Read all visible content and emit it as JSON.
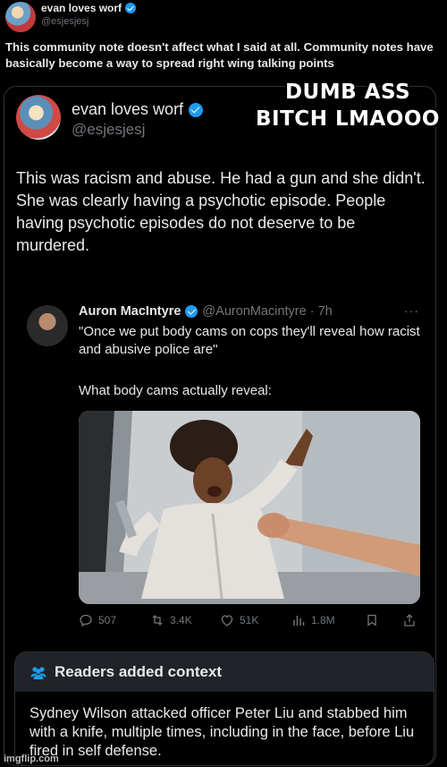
{
  "outer_tweet": {
    "name": "evan loves worf",
    "handle": "@esjesjesj",
    "text": "This community note doesn't affect what I said at all. Community notes have basically become a way to spread right wing talking points"
  },
  "meme_caption": "DUMB ASS BITCH LMAOOO",
  "quoted_tweet": {
    "name": "evan loves worf",
    "handle": "@esjesjesj",
    "text": "This was racism and abuse. He had a gun and she didn't. She was clearly having a psychotic episode. People having psychotic episodes do not deserve to be murdered."
  },
  "inner_tweet": {
    "name": "Auron MacIntyre",
    "handle_time": "@AuronMacintyre · 7h",
    "more": "···",
    "quote_text": "\"Once we put body cams on cops they'll reveal how racist and abusive police are\"",
    "caption": "What body cams actually reveal:",
    "actions": {
      "replies": "507",
      "reposts": "3.4K",
      "likes": "51K",
      "views": "1.8M"
    }
  },
  "community_note": {
    "header": "Readers added context",
    "text": "Sydney Wilson attacked officer Peter Liu and stabbed him with a knife, multiple times, including in the face, before Liu fired in self defense."
  },
  "watermark": "imgflip.com",
  "colors": {
    "background": "#000000",
    "text": "#e7e9ea",
    "secondary": "#71767b",
    "border": "#2f3336",
    "verified": "#1d9bf0",
    "note_header_bg": "#202327"
  },
  "icons": [
    "verified-badge-icon",
    "reply-icon",
    "repost-icon",
    "like-icon",
    "views-icon",
    "bookmark-icon",
    "share-icon",
    "readers-icon"
  ]
}
